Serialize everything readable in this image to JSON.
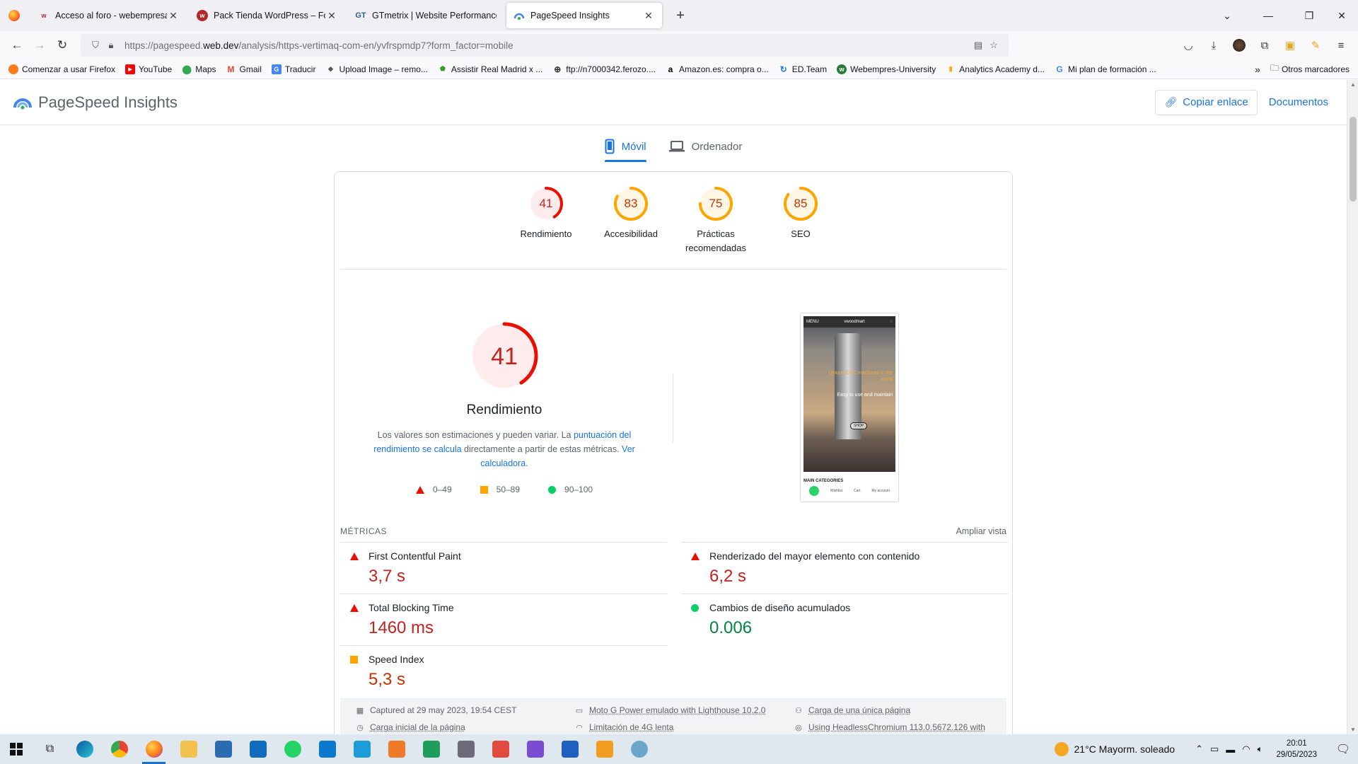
{
  "browser": {
    "tabs": [
      {
        "title": "Acceso al foro - webempresa.c",
        "favicon": "webempresa-icon",
        "active": false
      },
      {
        "title": "Pack Tienda WordPress – Foro",
        "favicon": "webempresa-icon",
        "active": false
      },
      {
        "title": "GTmetrix | Website Performance",
        "favicon": "gtmetrix-icon",
        "active": false
      },
      {
        "title": "PageSpeed Insights",
        "favicon": "pagespeed-icon",
        "active": true
      }
    ],
    "url_prefix": "https://pagespeed.",
    "url_domain": "web.dev",
    "url_rest": "/analysis/https-vertimaq-com-en/yvfrspmdp7?form_factor=mobile",
    "bookmarks": [
      "Comenzar a usar Firefox",
      "YouTube",
      "Maps",
      "Gmail",
      "Traducir",
      "Upload Image – remo...",
      "Assistir Real Madrid x ...",
      "ftp://n7000342.ferozo....",
      "Amazon.es: compra o...",
      "ED.Team",
      "Webempres-University",
      "Analytics Academy  d...",
      "Mi plan de formación ..."
    ],
    "other_bookmarks": "Otros marcadores"
  },
  "header": {
    "brand": "PageSpeed Insights",
    "copy_link": "Copiar enlace",
    "docs": "Documentos"
  },
  "device_tabs": {
    "mobile": "Móvil",
    "desktop": "Ordenador"
  },
  "gauges": [
    {
      "score": "41",
      "value": 41,
      "label_1": "Rendimiento",
      "label_2": "",
      "status": "fail"
    },
    {
      "score": "83",
      "value": 83,
      "label_1": "Accesibilidad",
      "label_2": "",
      "status": "average"
    },
    {
      "score": "75",
      "value": 75,
      "label_1": "Prácticas",
      "label_2": "recomendadas",
      "status": "average"
    },
    {
      "score": "85",
      "value": 85,
      "label_1": "SEO",
      "label_2": "",
      "status": "average"
    }
  ],
  "performance": {
    "score": "41",
    "value": 41,
    "title": "Rendimiento",
    "desc_1": "Los valores son estimaciones y pueden variar. La ",
    "desc_link_1": "puntuación del rendimiento se calcula",
    "desc_2": " directamente a partir de estas métricas. ",
    "desc_link_2": "Ver calculadora",
    "desc_3": ".",
    "legend": [
      "0–49",
      "50–89",
      "90–100"
    ]
  },
  "screenshot": {
    "menu": "MENU",
    "logo": "vwoodmart",
    "headline": "Unique CNC machines in the world",
    "subline": "Easy to use and maintain",
    "shop": "SHOP",
    "categories": "MAIN CATEGORIES",
    "footer": [
      "Wishlist",
      "Cart",
      "My account"
    ]
  },
  "metrics": {
    "heading": "MÉTRICAS",
    "expand": "Ampliar vista",
    "items": [
      {
        "name": "First Contentful Paint",
        "value": "3,7 s",
        "status": "fail"
      },
      {
        "name": "Renderizado del mayor elemento con contenido",
        "value": "6,2 s",
        "status": "fail"
      },
      {
        "name": "Total Blocking Time",
        "value": "1460 ms",
        "status": "fail"
      },
      {
        "name": "Cambios de diseño acumulados",
        "value": "0.006",
        "status": "pass"
      },
      {
        "name": "Speed Index",
        "value": "5,3 s",
        "status": "average"
      }
    ]
  },
  "runtime": {
    "captured": "Captured at 29 may 2023, 19:54 CEST",
    "device": "Moto G Power emulado with Lighthouse 10.2.0",
    "session": "Carga de una única página",
    "initial": "Carga inicial de la página",
    "throttle": "Limitación de 4G lenta",
    "browser": "Using HeadlessChromium 113.0.5672.126 with"
  },
  "taskbar": {
    "weather": "21°C  Mayorm. soleado",
    "time": "20:01",
    "date": "29/05/2023"
  },
  "colors": {
    "fail": "#eb0f00",
    "average": "#ffa400",
    "pass": "#0cce6b",
    "link": "#1a73e8"
  }
}
